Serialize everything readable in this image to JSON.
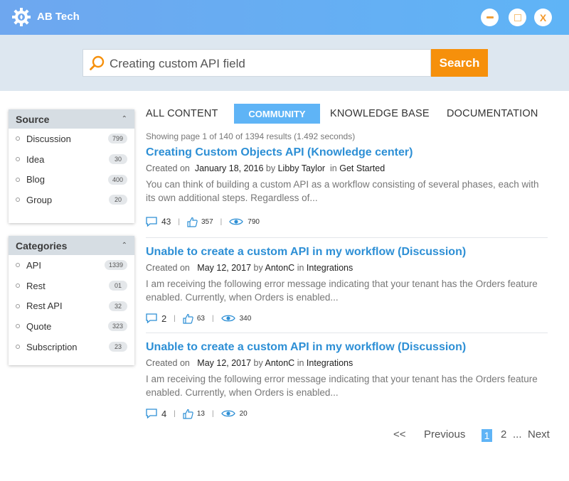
{
  "window": {
    "title": "AB Tech",
    "icons": {
      "logo": "gear-logo-icon",
      "minimize": "minimize-icon",
      "maximize": "maximize-icon",
      "close_label": "X"
    }
  },
  "search": {
    "query": "Creating custom API field",
    "button_label": "Search",
    "icon": "search-icon"
  },
  "sidebar": {
    "source": {
      "title": "Source",
      "items": [
        {
          "label": "Discussion",
          "count": "799"
        },
        {
          "label": "Idea",
          "count": "30"
        },
        {
          "label": "Blog",
          "count": "400"
        },
        {
          "label": "Group",
          "count": "20"
        }
      ]
    },
    "categories": {
      "title": "Categories",
      "items": [
        {
          "label": "API",
          "count": "1339"
        },
        {
          "label": "Rest",
          "count": "01"
        },
        {
          "label": "Rest API",
          "count": "32"
        },
        {
          "label": "Quote",
          "count": "323"
        },
        {
          "label": "Subscription",
          "count": "23"
        }
      ]
    }
  },
  "tabs": {
    "all": "ALL CONTENT",
    "community": "COMMUNITY",
    "knowledge": "KNOWLEDGE BASE",
    "documentation": "DOCUMENTATION"
  },
  "results_info": "Showing page 1 of 140 of 1394 results (1.492 seconds)",
  "results": [
    {
      "title": "Creating Custom Objects API (Knowledge center)",
      "created_on": "Created on",
      "date": "January 18, 2016",
      "by": "by",
      "author": "Libby Taylor",
      "in": "in",
      "category": "Get Started",
      "snippet": "You can think of building a custom API as a workflow consisting of several phases, each with its own additional steps. Regardless of...",
      "comments": "43",
      "likes": "357",
      "views": "790"
    },
    {
      "title": "Unable to create a custom API in my workflow (Discussion)",
      "created_on": "Created on",
      "date": "May 12, 2017",
      "by": "by",
      "author": "AntonC",
      "in": "in",
      "category": "Integrations",
      "snippet": "I am receiving the following error message indicating that your tenant has the Orders feature enabled. Currently, when Orders is enabled...",
      "comments": "2",
      "likes": "63",
      "views": "340"
    },
    {
      "title": "Unable to create a custom API in my workflow (Discussion)",
      "created_on": "Created on",
      "date": "May 12, 2017",
      "by": "by",
      "author": "AntonC",
      "in": "in",
      "category": "Integrations",
      "snippet": "I am receiving the following error message indicating that your tenant has the Orders feature enabled. Currently, when Orders is enabled...",
      "comments": "4",
      "likes": "13",
      "views": "20"
    }
  ],
  "pagination": {
    "first": "<<",
    "previous": "Previous",
    "current": "1",
    "next_page": "2",
    "ellipsis": "...",
    "next": "Next"
  },
  "colors": {
    "titlebar": "#5fb4f6",
    "accent": "#2d8fd5",
    "search_button": "#f6900b",
    "active_tab": "#5fb4f6"
  }
}
